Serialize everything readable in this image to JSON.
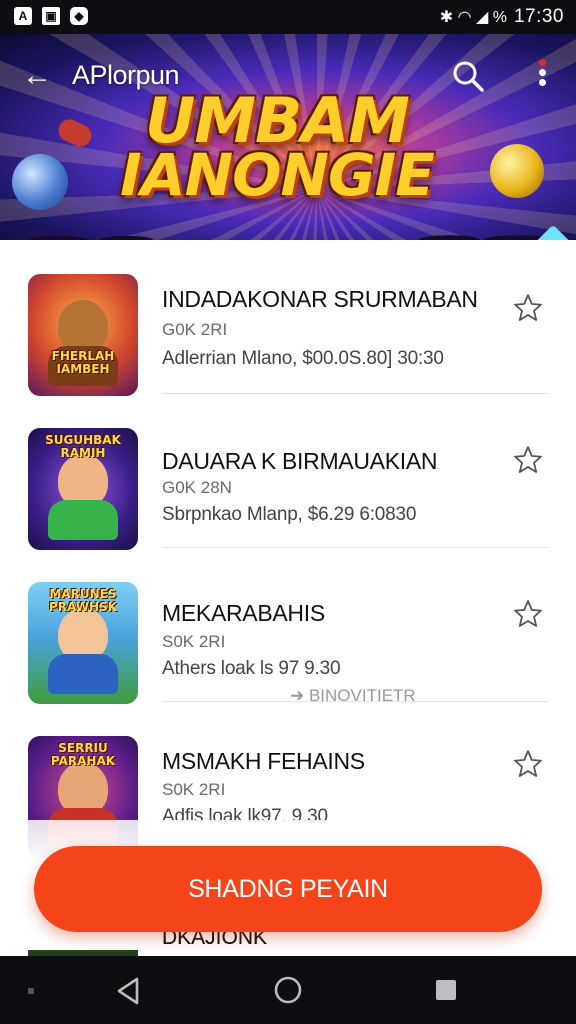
{
  "status_bar": {
    "left_icons": [
      "A",
      "image-icon",
      "shield-icon"
    ],
    "left_letters": [
      "A",
      "▣",
      "◆"
    ],
    "indicators": "✱  ◠ ◢ %",
    "time": "17:30"
  },
  "header": {
    "title": "APlorpun",
    "banner_line1": "UMBAM",
    "banner_line2": "IANONGIE",
    "back_icon": "←",
    "accent": "#f5441a"
  },
  "list": {
    "items": [
      {
        "title": "INDADAKONAR SRURMABAN",
        "sub": "G0K 2RI",
        "meta": "Adlerrian Mlano,  $00.0S.80] 30:30",
        "extra": "",
        "thumb_text": "FHERLAH\nIAMBEH"
      },
      {
        "title": "DAUARA K BIRMAUAKIAN",
        "sub": "G0K 28N",
        "meta": "Sbrpnkao Mlanp,  $6.29 6:0830",
        "extra": "",
        "thumb_text": "SUGUHBAK\nRAMIH"
      },
      {
        "title": "MEKARABAHIS",
        "sub": "S0K 2RI",
        "meta": "Athers loak ls 97  9.30",
        "extra": "➜  BINOVITIETR",
        "thumb_text": "MARUNES\nPRAWHSK"
      },
      {
        "title": "MSMAKH FEHAINS",
        "sub": "S0K 2RI",
        "meta": "Adfis loak lk97.  9.30",
        "extra": "",
        "thumb_text": "SERRIU\nPARAHAK"
      }
    ],
    "peek_title": "DKAJIONK"
  },
  "cta": {
    "label": "SHADNG PEYAIN"
  },
  "nav": {
    "back": "back-icon",
    "home": "home-icon",
    "recent": "recent-apps-icon"
  }
}
